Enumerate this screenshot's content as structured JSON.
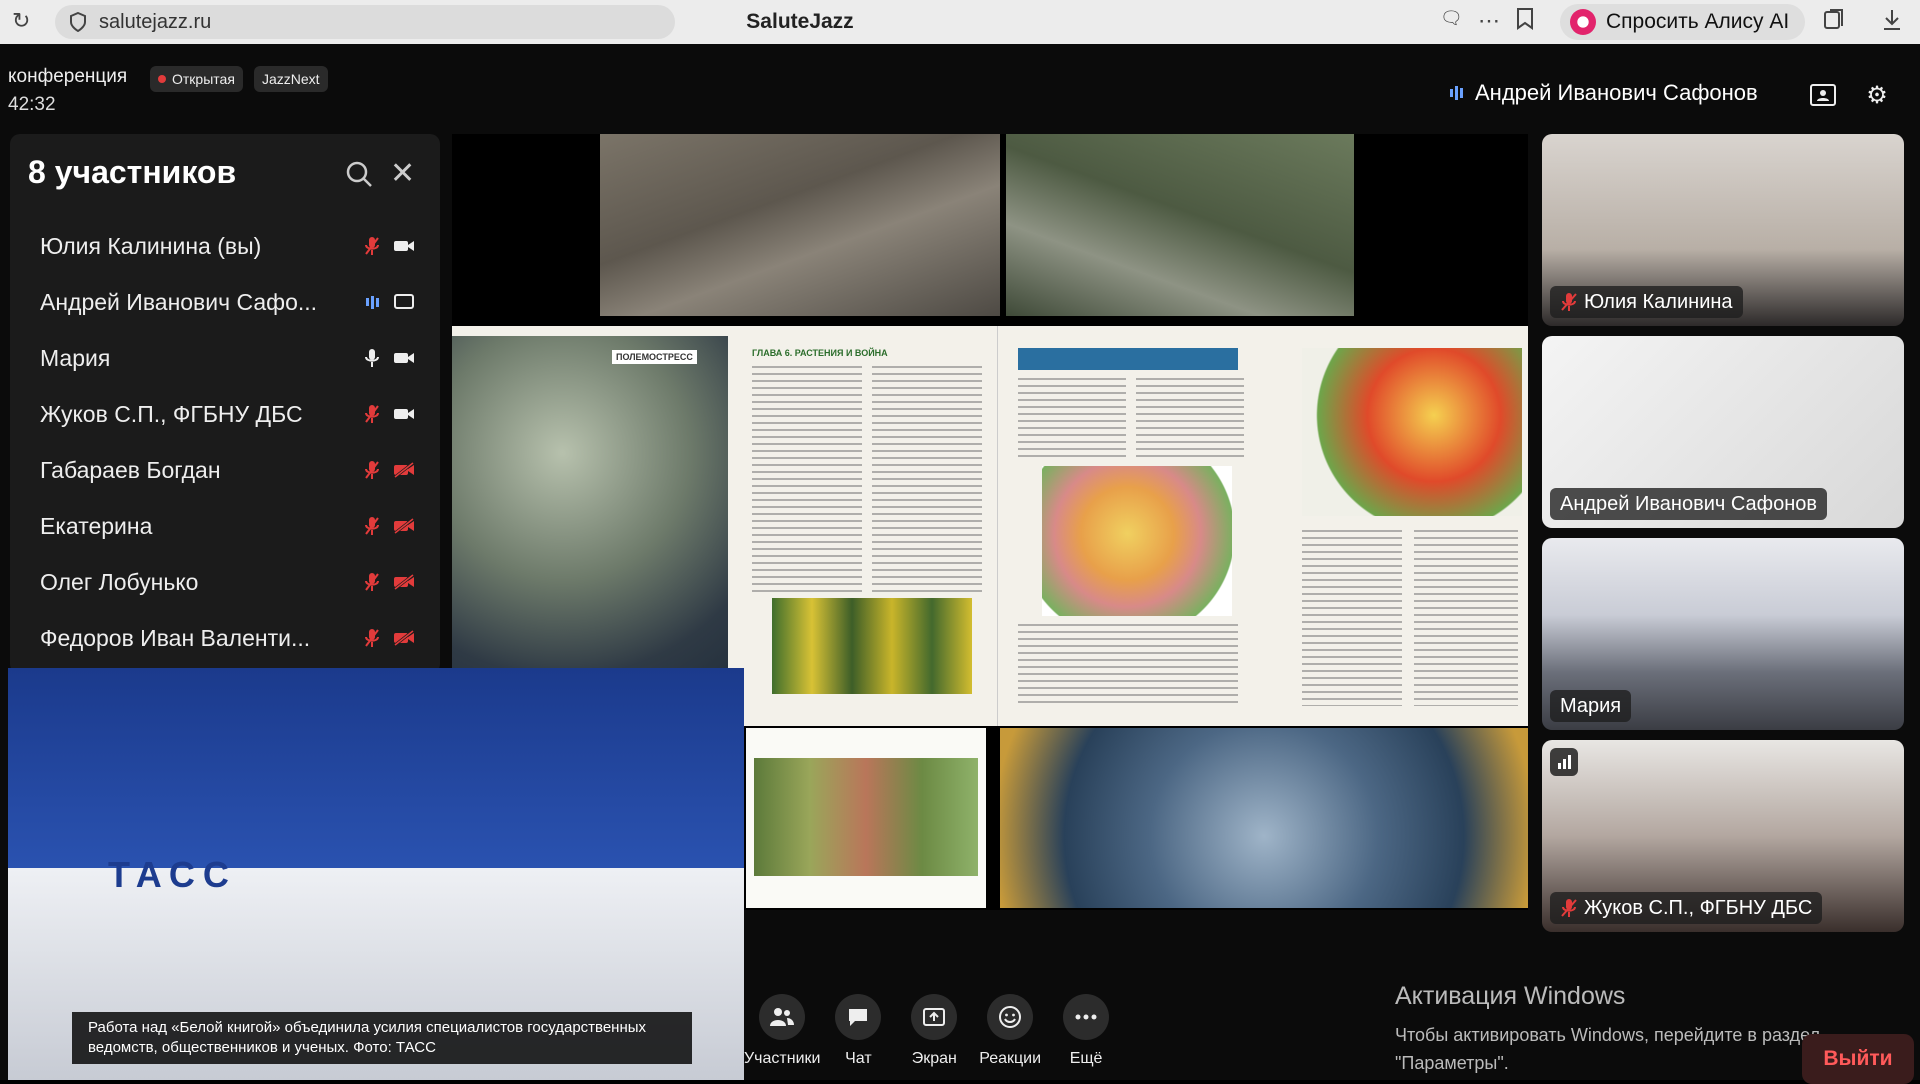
{
  "browser": {
    "url": "salutejazz.ru",
    "title": "SaluteJazz",
    "alice_button": "Спросить Алису AI"
  },
  "conference": {
    "title": "конференция",
    "tag_open": "Открытая",
    "tag_next": "JazzNext",
    "elapsed": "42:32",
    "active_speaker": "Андрей Иванович Сафонов"
  },
  "participants_panel": {
    "title": "8 участников",
    "items": [
      {
        "name": "Юлия Калинина (вы)",
        "mic": "muted",
        "cam": "on"
      },
      {
        "name": "Андрей Иванович Сафо...",
        "mic": "speaking",
        "cam": "screen"
      },
      {
        "name": "Мария",
        "mic": "on",
        "cam": "on"
      },
      {
        "name": "Жуков С.П., ФГБНУ ДБС",
        "mic": "muted",
        "cam": "on"
      },
      {
        "name": "Габараев Богдан",
        "mic": "muted",
        "cam": "off"
      },
      {
        "name": "Екатерина",
        "mic": "muted",
        "cam": "off"
      },
      {
        "name": "Олег Лобунько",
        "mic": "muted",
        "cam": "off"
      },
      {
        "name": "Федоров Иван Валенти...",
        "mic": "muted",
        "cam": "off"
      }
    ]
  },
  "shared_screen": {
    "page_left_badge": "ПОЛЕМОСТРЕСС",
    "chapter_heading": "ГЛАВА 6. РАСТЕНИЯ И ВОЙНА"
  },
  "video_tiles": [
    {
      "name": "Юлия Калинина",
      "mic": "muted"
    },
    {
      "name": "Андрей Иванович Сафонов",
      "mic": "none"
    },
    {
      "name": "Мария",
      "mic": "none"
    },
    {
      "name": "Жуков С.П., ФГБНУ ДБС",
      "mic": "muted"
    }
  ],
  "pip": {
    "caption": "Работа над «Белой книгой» объединила усилия специалистов государственных ведомств, общественников и ученых. Фото: ТАСС",
    "banner_word": "ТАСС"
  },
  "toolbar": {
    "participants": "Участники",
    "chat": "Чат",
    "screen": "Экран",
    "reactions": "Реакции",
    "more": "Ещё"
  },
  "windows_activation": {
    "title": "Активация Windows",
    "text": "Чтобы активировать Windows, перейдите в раздел \"Параметры\"."
  },
  "exit_label": "Выйти",
  "colors": {
    "accent_blue": "#6aa1ff",
    "muted_red": "#e23b3b",
    "panel_bg": "#1b1b1b",
    "exit_red": "#ff5a5a"
  }
}
